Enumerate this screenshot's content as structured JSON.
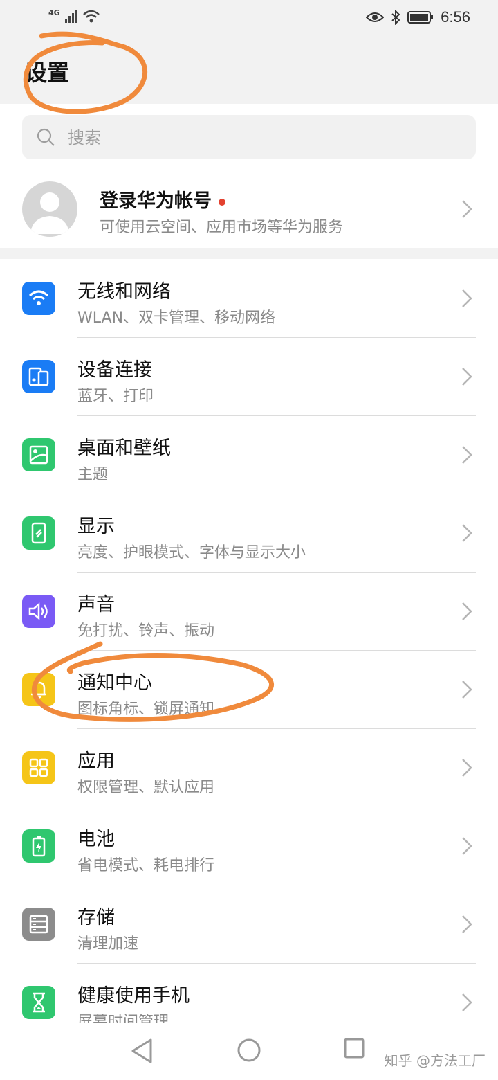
{
  "status_bar": {
    "network": "4G",
    "time": "6:56"
  },
  "header": {
    "title": "设置"
  },
  "search": {
    "placeholder": "搜索"
  },
  "account": {
    "title": "登录华为帐号",
    "subtitle": "可使用云空间、应用市场等华为服务"
  },
  "settings": [
    {
      "title": "无线和网络",
      "subtitle": "WLAN、双卡管理、移动网络",
      "icon": "wifi-icon",
      "color": "#1a7cf5"
    },
    {
      "title": "设备连接",
      "subtitle": "蓝牙、打印",
      "icon": "device-connect-icon",
      "color": "#1a7cf5"
    },
    {
      "title": "桌面和壁纸",
      "subtitle": "主题",
      "icon": "wallpaper-icon",
      "color": "#2fc76f"
    },
    {
      "title": "显示",
      "subtitle": "亮度、护眼模式、字体与显示大小",
      "icon": "display-icon",
      "color": "#2fc76f"
    },
    {
      "title": "声音",
      "subtitle": "免打扰、铃声、振动",
      "icon": "sound-icon",
      "color": "#7a5af5"
    },
    {
      "title": "通知中心",
      "subtitle": "图标角标、锁屏通知",
      "icon": "bell-icon",
      "color": "#f5c518"
    },
    {
      "title": "应用",
      "subtitle": "权限管理、默认应用",
      "icon": "apps-icon",
      "color": "#f5c518"
    },
    {
      "title": "电池",
      "subtitle": "省电模式、耗电排行",
      "icon": "battery-icon",
      "color": "#2fc76f"
    },
    {
      "title": "存储",
      "subtitle": "清理加速",
      "icon": "storage-icon",
      "color": "#8c8c8c"
    },
    {
      "title": "健康使用手机",
      "subtitle": "屏幕时间管理",
      "icon": "hourglass-icon",
      "color": "#2fc76f"
    }
  ],
  "watermark": "知乎 @方法工厂"
}
